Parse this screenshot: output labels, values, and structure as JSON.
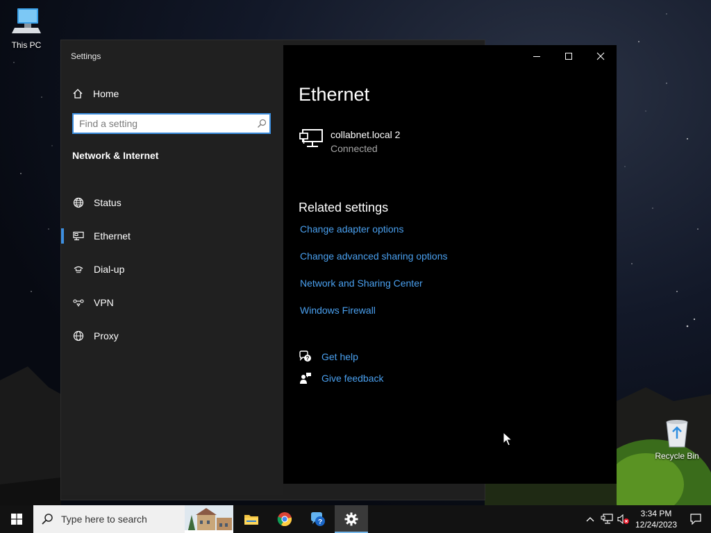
{
  "desktop": {
    "icons": [
      {
        "label": "This PC"
      },
      {
        "label": "Recycle Bin"
      }
    ]
  },
  "window": {
    "title": "Settings",
    "controls": {
      "minimize": "minimize",
      "maximize": "maximize",
      "close": "close"
    }
  },
  "sidebar": {
    "home_label": "Home",
    "search_placeholder": "Find a setting",
    "search_value": "",
    "section_heading": "Network & Internet",
    "items": [
      {
        "label": "Status",
        "icon": "globe-status-icon",
        "selected": false
      },
      {
        "label": "Ethernet",
        "icon": "ethernet-icon",
        "selected": true
      },
      {
        "label": "Dial-up",
        "icon": "dialup-icon",
        "selected": false
      },
      {
        "label": "VPN",
        "icon": "vpn-icon",
        "selected": false
      },
      {
        "label": "Proxy",
        "icon": "globe-icon",
        "selected": false
      }
    ]
  },
  "main": {
    "title": "Ethernet",
    "network": {
      "name": "collabnet.local 2",
      "status": "Connected",
      "icon": "ethernet-monitor-icon"
    },
    "related_heading": "Related settings",
    "related_links": [
      "Change adapter options",
      "Change advanced sharing options",
      "Network and Sharing Center",
      "Windows Firewall"
    ],
    "help": {
      "get_help": "Get help",
      "give_feedback": "Give feedback"
    }
  },
  "taskbar": {
    "search_placeholder": "Type here to search",
    "apps": [
      {
        "name": "file-explorer-icon",
        "active": false
      },
      {
        "name": "chrome-icon",
        "active": false
      },
      {
        "name": "get-help-app-icon",
        "active": false
      },
      {
        "name": "settings-gear-icon",
        "active": true
      }
    ],
    "clock": {
      "time": "3:34 PM",
      "date": "12/24/2023"
    }
  },
  "colors": {
    "accent": "#3d8fe0",
    "link": "#4aa0ef",
    "sidebar_bg": "#202020",
    "content_bg": "#000000",
    "taskbar_bg": "#121212"
  }
}
